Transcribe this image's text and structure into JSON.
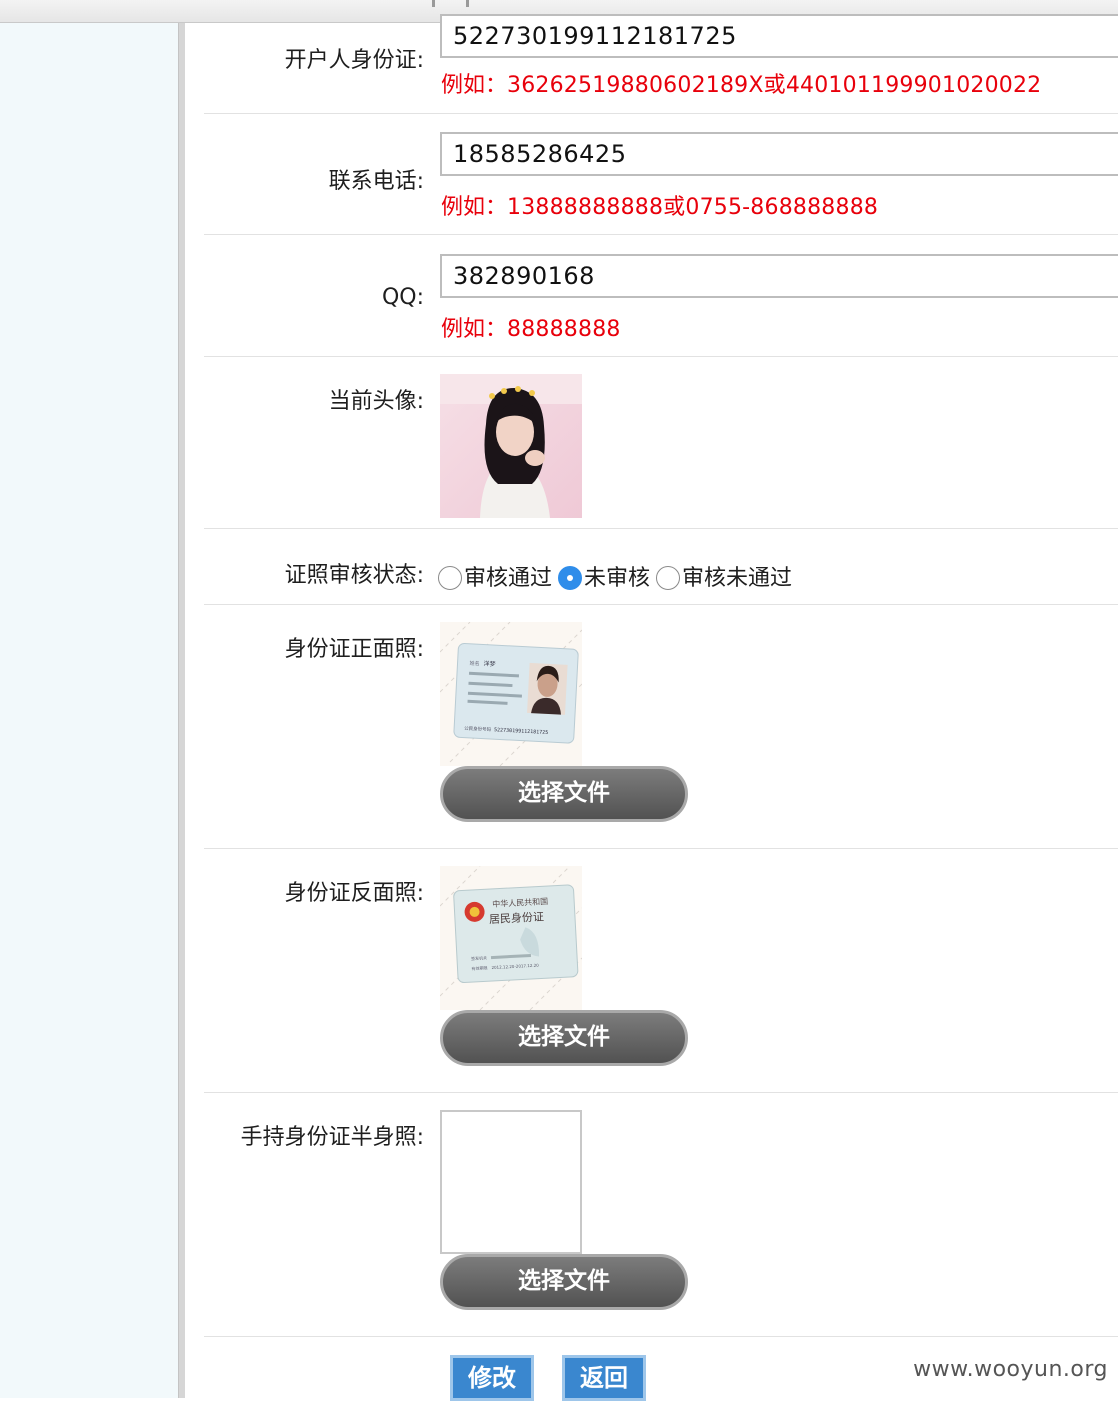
{
  "form": {
    "id_card": {
      "label": "开户人身份证:",
      "value": "522730199112181725",
      "hint_prefix": "例如：",
      "hint_value": "36262519880602189X或440101199901020022"
    },
    "phone": {
      "label": "联系电话:",
      "value": "18585286425",
      "hint_prefix": "例如：",
      "hint_value": "13888888888或0755-868888888"
    },
    "qq": {
      "label": "QQ:",
      "value": "382890168",
      "hint_prefix": "例如：",
      "hint_value": "88888888"
    },
    "avatar": {
      "label": "当前头像:"
    },
    "review_status": {
      "label": "证照审核状态:",
      "options": [
        {
          "label": "审核通过",
          "selected": false
        },
        {
          "label": "未审核",
          "selected": true
        },
        {
          "label": "审核未通过",
          "selected": false
        }
      ]
    },
    "id_front": {
      "label": "身份证正面照:",
      "button": "选择文件"
    },
    "id_back": {
      "label": "身份证反面照:",
      "button": "选择文件"
    },
    "id_handheld": {
      "label": "手持身份证半身照:",
      "button": "选择文件"
    },
    "actions": {
      "submit": "修改",
      "back": "返回"
    }
  },
  "id_front_card": {
    "name_key": "姓名",
    "name": "洋梦",
    "number_key": "公民身份号码",
    "number": "522730199112181725"
  },
  "id_back_card": {
    "line1": "中华人民共和国",
    "line2": "居民身份证",
    "authority_key": "签发机关",
    "validity_key": "有效期限",
    "validity": "2012.12.20-2017.12.20"
  },
  "watermark": "www.wooyun.org",
  "colors": {
    "hint": "#e8000b",
    "accent": "#3a87cf",
    "radio_selected": "#2f8dea"
  }
}
